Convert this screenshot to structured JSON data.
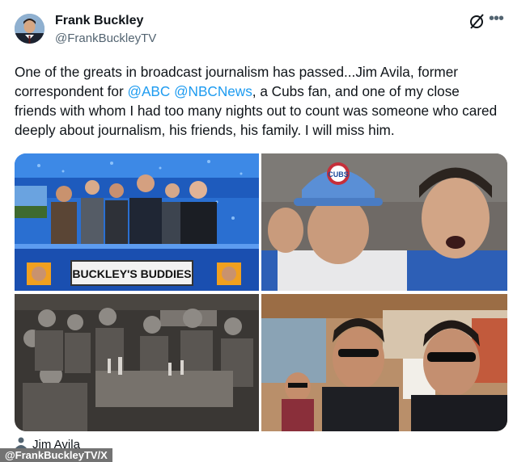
{
  "author": {
    "name": "Frank Buckley",
    "handle": "@FrankBuckleyTV"
  },
  "post": {
    "text_before": "One of the greats in broadcast journalism has passed...Jim Avila, former correspondent for ",
    "mention_1": "@ABC",
    "mention_2": "@NBCNews",
    "text_after": ", a Cubs fan, and one of my close friends with whom I had too many nights out to count was someone who cared deeply about journalism, his friends, his family. I will miss him."
  },
  "photos": {
    "studio_sign": "BUCKLEY'S BUDDIES",
    "cap_logo": "CUBS"
  },
  "tagged": {
    "name": "Jim Avila"
  },
  "credit": "@FrankBuckleyTV/X",
  "icons": {
    "grok": "grok-icon",
    "more": "more-icon",
    "person": "person-icon"
  },
  "colors": {
    "link": "#1d9bf0",
    "handle": "#536471",
    "studio_blue": "#1e5bbd",
    "cubs_blue": "#2d5fb6"
  }
}
